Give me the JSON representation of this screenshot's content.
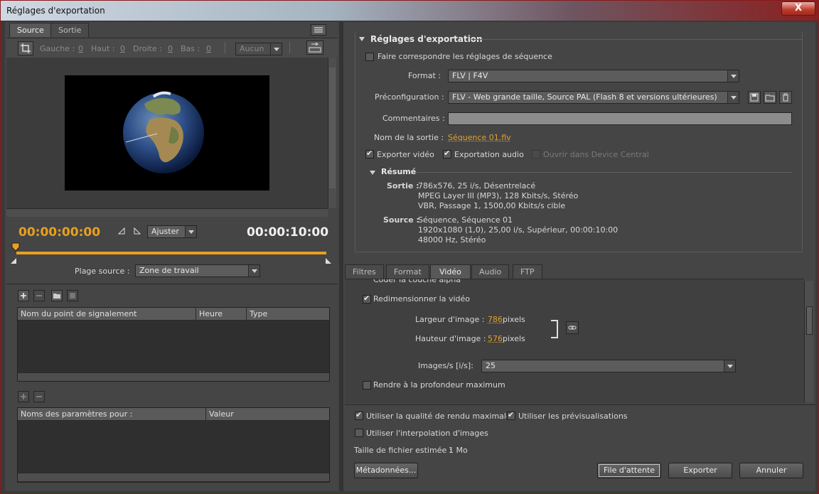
{
  "window": {
    "title": "Réglages d'exportation",
    "close": "X"
  },
  "left": {
    "tabs": [
      "Source",
      "Sortie"
    ],
    "crop": {
      "gauche_label": "Gauche :",
      "gauche_val": "0",
      "haut_label": "Haut :",
      "haut_val": "0",
      "droite_label": "Droite :",
      "droite_val": "0",
      "bas_label": "Bas :",
      "bas_val": "0",
      "ratio": "Aucun"
    },
    "timecode_start": "00:00:00:00",
    "timecode_end": "00:00:10:00",
    "zoom": "Ajuster",
    "source_range_label": "Plage source :",
    "source_range_value": "Zone de travail",
    "cue_table": {
      "headers": [
        "Nom du point de signalement",
        "Heure",
        "Type"
      ]
    },
    "param_table": {
      "headers": [
        "Noms des paramètres pour :",
        "Valeur"
      ]
    }
  },
  "right": {
    "section_title": "Réglages d'exportation",
    "match_sequence": "Faire correspondre les réglages de séquence",
    "format_label": "Format :",
    "format_value": "FLV | F4V",
    "preset_label": "Préconfiguration :",
    "preset_value": "FLV - Web grande taille, Source PAL (Flash 8 et versions ultérieures)",
    "comments_label": "Commentaires :",
    "output_name_label": "Nom de la sortie :",
    "output_name_value": "Séquence 01.flv",
    "export_video": "Exporter vidéo",
    "export_audio": "Exportation audio",
    "open_device_central": "Ouvrir dans Device Central",
    "summary_title": "Résumé",
    "summary": {
      "sortie_label": "Sortie :",
      "sortie_lines": [
        "786x576, 25 i/s, Désentrelacé",
        "MPEG Layer III (MP3), 128 Kbits/s, Stéréo",
        "VBR, Passage 1, 1500,00 Kbits/s cible"
      ],
      "source_label": "Source :",
      "source_lines": [
        "Séquence, Séquence 01",
        "1920x1080 (1,0), 25,00 i/s, Supérieur, 00:00:10:00",
        "48000 Hz, Stéréo"
      ]
    },
    "tabs": [
      "Filtres",
      "Format",
      "Vidéo",
      "Audio",
      "FTP"
    ],
    "video": {
      "alpha_partial": "Coder la couche alpha",
      "resize": "Redimensionner la vidéo",
      "width_label": "Largeur d'image :",
      "width_value": "786",
      "height_label": "Hauteur d'image :",
      "height_value": "576",
      "unit": "pixels",
      "fps_label": "Images/s [i/s]:",
      "fps_value": "25",
      "max_depth": "Rendre à la profondeur maximum"
    },
    "bottom": {
      "max_quality": "Utiliser la qualité de rendu maximale",
      "use_previews": "Utiliser les prévisualisations",
      "interpolation": "Utiliser l'interpolation d'images",
      "size_label": "Taille de fichier estimée :",
      "size_value": "1 Mo"
    },
    "buttons": {
      "metadata": "Métadonnées...",
      "queue": "File d'attente",
      "export": "Exporter",
      "cancel": "Annuler"
    }
  },
  "colors": {
    "accent": "#e8a020",
    "panel": "#454545",
    "window_border": "#8a1a1a"
  }
}
